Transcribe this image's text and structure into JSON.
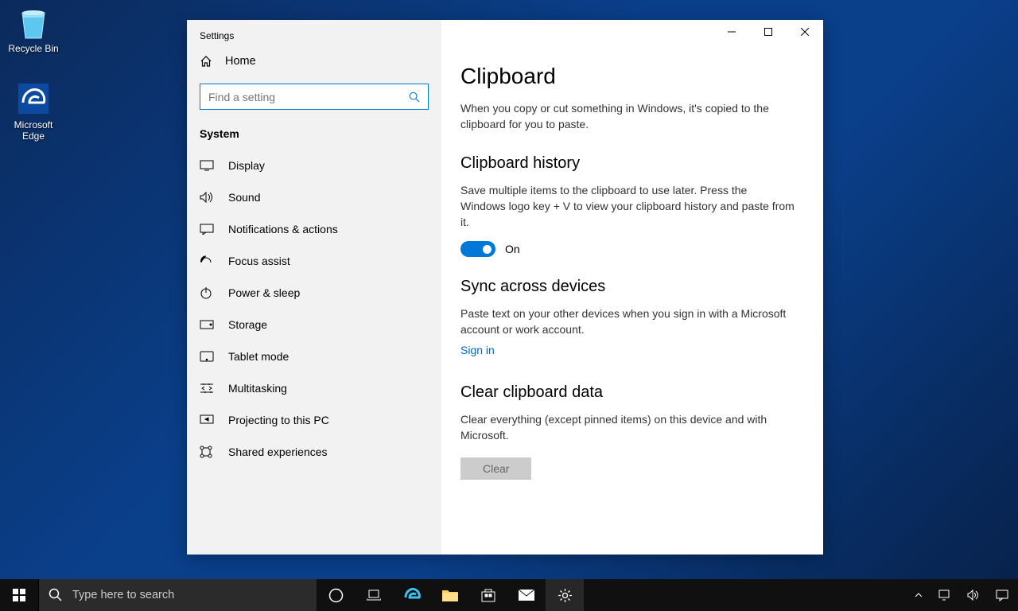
{
  "desktop": {
    "recycle_bin": "Recycle Bin",
    "edge": "Microsoft Edge"
  },
  "window": {
    "title": "Settings",
    "home": "Home",
    "search_placeholder": "Find a setting",
    "category": "System",
    "nav": [
      {
        "label": "Display"
      },
      {
        "label": "Sound"
      },
      {
        "label": "Notifications & actions"
      },
      {
        "label": "Focus assist"
      },
      {
        "label": "Power & sleep"
      },
      {
        "label": "Storage"
      },
      {
        "label": "Tablet mode"
      },
      {
        "label": "Multitasking"
      },
      {
        "label": "Projecting to this PC"
      },
      {
        "label": "Shared experiences"
      }
    ]
  },
  "page": {
    "title": "Clipboard",
    "intro": "When you copy or cut something in Windows, it's copied to the clipboard for you to paste.",
    "history": {
      "title": "Clipboard history",
      "desc": "Save multiple items to the clipboard to use later. Press the Windows logo key + V to view your clipboard history and paste from it.",
      "toggle_state": "On"
    },
    "sync": {
      "title": "Sync across devices",
      "desc": "Paste text on your other devices when you sign in with a Microsoft account or work account.",
      "link": "Sign in"
    },
    "clear": {
      "title": "Clear clipboard data",
      "desc": "Clear everything (except pinned items) on this device and with Microsoft.",
      "button": "Clear"
    }
  },
  "taskbar": {
    "search_placeholder": "Type here to search"
  }
}
